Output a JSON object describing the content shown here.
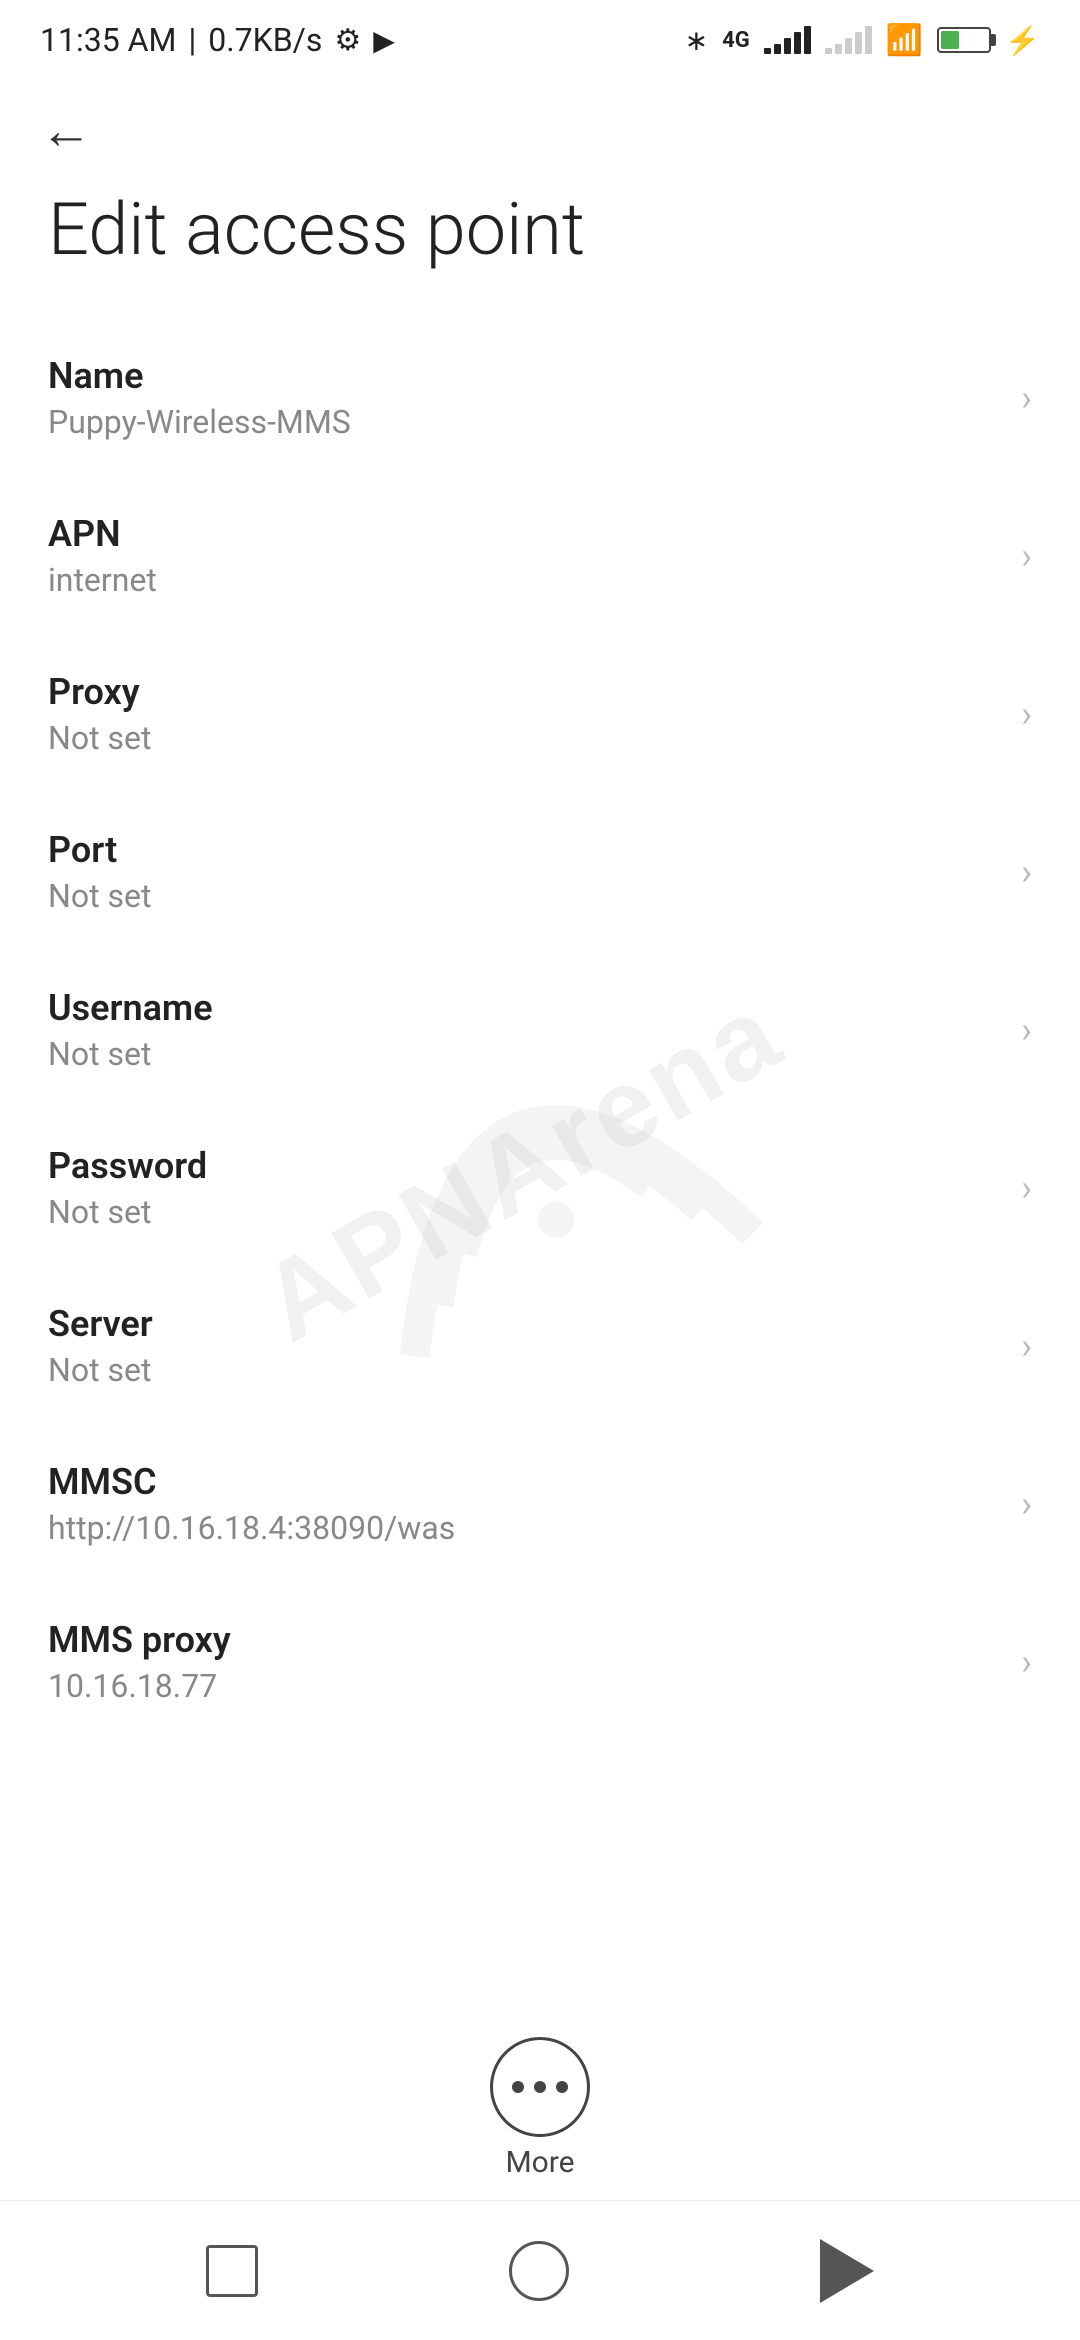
{
  "statusBar": {
    "time": "11:35 AM",
    "speed": "0.7KB/s",
    "battery": "38",
    "batteryPercent": "38%"
  },
  "topBar": {
    "backArrow": "←"
  },
  "page": {
    "title": "Edit access point"
  },
  "settings": [
    {
      "id": "name",
      "label": "Name",
      "value": "Puppy-Wireless-MMS"
    },
    {
      "id": "apn",
      "label": "APN",
      "value": "internet"
    },
    {
      "id": "proxy",
      "label": "Proxy",
      "value": "Not set"
    },
    {
      "id": "port",
      "label": "Port",
      "value": "Not set"
    },
    {
      "id": "username",
      "label": "Username",
      "value": "Not set"
    },
    {
      "id": "password",
      "label": "Password",
      "value": "Not set"
    },
    {
      "id": "server",
      "label": "Server",
      "value": "Not set"
    },
    {
      "id": "mmsc",
      "label": "MMSC",
      "value": "http://10.16.18.4:38090/was"
    },
    {
      "id": "mms-proxy",
      "label": "MMS proxy",
      "value": "10.16.18.77"
    }
  ],
  "moreButton": {
    "label": "More"
  },
  "bottomNav": {
    "squareLabel": "recent",
    "circleLabel": "home",
    "triangleLabel": "back"
  },
  "watermark": "APNArena"
}
